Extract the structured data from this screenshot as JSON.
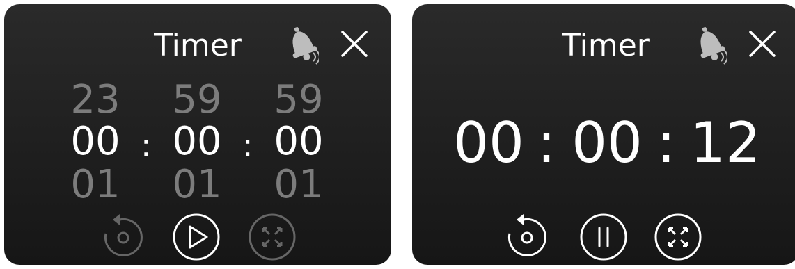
{
  "left_panel": {
    "title": "Timer",
    "picker": {
      "hours": {
        "prev": "23",
        "current": "00",
        "next": "01"
      },
      "minutes": {
        "prev": "59",
        "current": "00",
        "next": "01"
      },
      "seconds": {
        "prev": "59",
        "current": "00",
        "next": "01"
      }
    },
    "separator": ":",
    "controls": [
      "reset-icon",
      "play-icon",
      "fullscreen-icon"
    ]
  },
  "right_panel": {
    "title": "Timer",
    "hours": "00",
    "minutes": "00",
    "seconds": "12",
    "separator": ":",
    "controls": [
      "reset-icon",
      "pause-icon",
      "fullscreen-icon"
    ]
  },
  "colors": {
    "panel_top": "#2a2a2a",
    "panel_bottom": "#161616",
    "text": "#ffffff",
    "dim_text": "#7c7c7c",
    "disabled_icon": "#666666",
    "bell": "#bdbdbd"
  }
}
